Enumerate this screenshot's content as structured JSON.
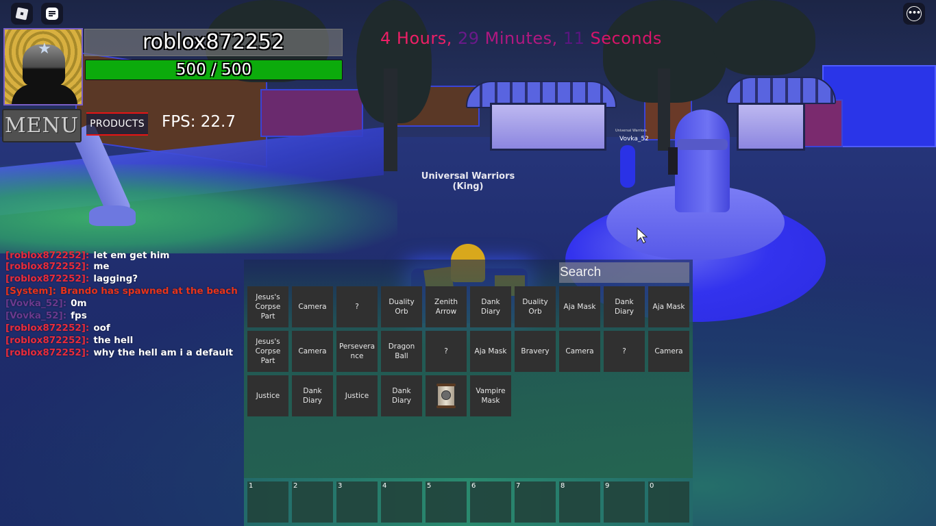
{
  "system_buttons": {
    "roblox_icon": "roblox-logo",
    "chat_icon": "chat-bubble",
    "more_icon": "more-options-ellipsis",
    "more_glyph": "•••"
  },
  "player": {
    "username": "roblox872252",
    "health_text": "500 / 500",
    "health_current": 500,
    "health_max": 500,
    "health_fraction": 1.0,
    "health_color": "#0cab0c"
  },
  "hud": {
    "menu_label": "MENU",
    "products_label": "PRODUCTS",
    "fps_text": "FPS: 22.7"
  },
  "timer": {
    "parts": [
      {
        "text": "4 Hours, ",
        "color": "#ee1f66"
      },
      {
        "text": "29 ",
        "color": "#6a1a8a"
      },
      {
        "text": "Minutes, ",
        "color": "#b01880"
      },
      {
        "text": "11 ",
        "color": "#5a1680"
      },
      {
        "text": "Seconds",
        "color": "#d8146a"
      }
    ]
  },
  "world": {
    "npc_title": "Universal Warriors",
    "npc_subtitle": "(King)",
    "player_tag_small": "Universal Warriors",
    "player_tag_name": "Vovka_52"
  },
  "chat": {
    "messages": [
      {
        "name": "[roblox872252]:",
        "text": "let em get him",
        "name_color": "#e82c3c",
        "system": false
      },
      {
        "name": "[roblox872252]:",
        "text": "me",
        "name_color": "#e82c3c",
        "system": false
      },
      {
        "name": "[roblox872252]:",
        "text": "lagging?",
        "name_color": "#e82c3c",
        "system": false
      },
      {
        "name": "[System]:",
        "text": "Brando has spawned at the beach!",
        "name_color": "#e8341c",
        "system": true
      },
      {
        "name": "[Vovka_52]:",
        "text": "0m",
        "name_color": "#6a3a8e",
        "system": false
      },
      {
        "name": "[Vovka_52]:",
        "text": "fps",
        "name_color": "#6a3a8e",
        "system": false
      },
      {
        "name": "[roblox872252]:",
        "text": "oof",
        "name_color": "#e82c3c",
        "system": false
      },
      {
        "name": "[roblox872252]:",
        "text": "the hell",
        "name_color": "#e82c3c",
        "system": false
      },
      {
        "name": "[roblox872252]:",
        "text": "why the hell am i a default",
        "name_color": "#e82c3c",
        "system": false
      }
    ]
  },
  "inventory": {
    "search_placeholder": "Search",
    "search_value": "",
    "items": [
      {
        "label": "Jesus's Corpse Part"
      },
      {
        "label": "Camera"
      },
      {
        "label": "?"
      },
      {
        "label": "Duality Orb"
      },
      {
        "label": "Zenith Arrow"
      },
      {
        "label": "Dank Diary"
      },
      {
        "label": "Duality Orb"
      },
      {
        "label": "Aja Mask"
      },
      {
        "label": "Dank Diary"
      },
      {
        "label": "Aja Mask"
      },
      {
        "label": "Jesus's Corpse Part"
      },
      {
        "label": "Camera"
      },
      {
        "label": "Perseverance"
      },
      {
        "label": "Dragon Ball"
      },
      {
        "label": "?"
      },
      {
        "label": "Aja Mask"
      },
      {
        "label": "Bravery"
      },
      {
        "label": "Camera"
      },
      {
        "label": "?"
      },
      {
        "label": "Camera"
      },
      {
        "label": "Justice"
      },
      {
        "label": "Dank Diary"
      },
      {
        "label": "Justice"
      },
      {
        "label": "Dank Diary"
      },
      {
        "label": "",
        "icon": "scroll-icon"
      },
      {
        "label": "Vampire Mask"
      }
    ]
  },
  "hotbar": {
    "slots": [
      "1",
      "2",
      "3",
      "4",
      "5",
      "6",
      "7",
      "8",
      "9",
      "0"
    ]
  }
}
